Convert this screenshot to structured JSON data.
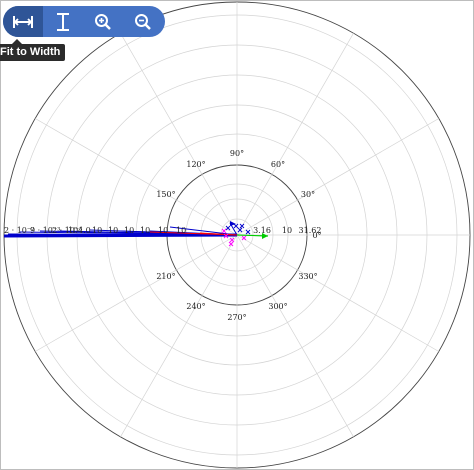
{
  "toolbar": {
    "buttons": [
      {
        "name": "fit-width",
        "icon": "fit-width-icon",
        "tooltip": "Fit to Width"
      },
      {
        "name": "fit-height",
        "icon": "fit-height-icon"
      },
      {
        "name": "zoom-in",
        "icon": "zoom-in-icon"
      },
      {
        "name": "zoom-out",
        "icon": "zoom-out-icon"
      }
    ],
    "tooltip_text": "Fit to Width",
    "color": "#4472c4"
  },
  "chart_data": {
    "type": "polar",
    "angle_labels": [
      "0°",
      "30°",
      "60°",
      "90°",
      "120°",
      "150°",
      "210°",
      "240°",
      "270°",
      "300°",
      "330°"
    ],
    "radial_labels": [
      "3.16",
      "10",
      "31.62"
    ],
    "left_labels": [
      "2 · 10⁻²",
      "9 · 10⁻³",
      "2 · 10⁻³",
      "10",
      "4.0",
      "10",
      "10",
      "10",
      "10",
      "10",
      "10"
    ],
    "grid": true,
    "series": [
      {
        "color": "#0000cc"
      },
      {
        "color": "#ff0000"
      },
      {
        "color": "#00cc00"
      },
      {
        "color": "#ff00ff"
      }
    ]
  }
}
